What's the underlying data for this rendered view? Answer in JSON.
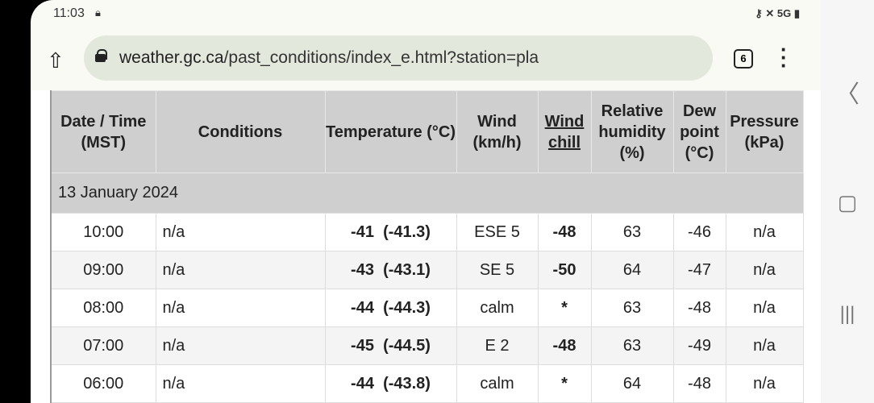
{
  "status": {
    "time": "11:03",
    "right": "5G"
  },
  "browser": {
    "url_domain": "weather.gc.ca",
    "url_path": "/past_conditions/index_e.html?station=pla",
    "tab_count": "6"
  },
  "table": {
    "headers": [
      "Date / Time (MST)",
      "Conditions",
      "Temperature (°C)",
      "Wind (km/h)",
      "Wind chill",
      "Relative humidity (%)",
      "Dew point (°C)",
      "Pressure (kPa)"
    ],
    "date_group": "13 January 2024",
    "rows": [
      {
        "time": "10:00",
        "conditions": "n/a",
        "temp": "-41",
        "temp_precise": "(-41.3)",
        "wind": "ESE 5",
        "chill": "-48",
        "rh": "63",
        "dew": "-46",
        "pressure": "n/a"
      },
      {
        "time": "09:00",
        "conditions": "n/a",
        "temp": "-43",
        "temp_precise": "(-43.1)",
        "wind": "SE 5",
        "chill": "-50",
        "rh": "64",
        "dew": "-47",
        "pressure": "n/a"
      },
      {
        "time": "08:00",
        "conditions": "n/a",
        "temp": "-44",
        "temp_precise": "(-44.3)",
        "wind": "calm",
        "chill": "*",
        "rh": "63",
        "dew": "-48",
        "pressure": "n/a"
      },
      {
        "time": "07:00",
        "conditions": "n/a",
        "temp": "-45",
        "temp_precise": "(-44.5)",
        "wind": "E 2",
        "chill": "-48",
        "rh": "63",
        "dew": "-49",
        "pressure": "n/a"
      },
      {
        "time": "06:00",
        "conditions": "n/a",
        "temp": "-44",
        "temp_precise": "(-43.8)",
        "wind": "calm",
        "chill": "*",
        "rh": "64",
        "dew": "-48",
        "pressure": "n/a"
      }
    ]
  }
}
